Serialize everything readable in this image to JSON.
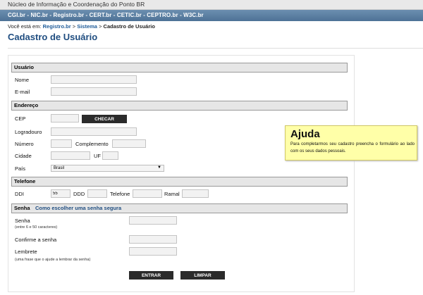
{
  "header": {
    "top_text": "Núcleo de Informação e Coordenação do Ponto BR",
    "nav_text": "CGI.br - NIC.br - Registro.br - CERT.br - CETIC.br - CEPTRO.br - W3C.br"
  },
  "breadcrumb": {
    "prefix": "Você está em:",
    "link1": "Registro.br",
    "sep1": " > ",
    "link2": "Sistema",
    "sep2": " > ",
    "current": "Cadastro de Usuário"
  },
  "page_title": "Cadastro de Usuário",
  "sections": {
    "usuario": "Usuário",
    "endereco": "Endereço",
    "telefone": "Telefone",
    "senha": "Senha",
    "senha_link": "Como escolher uma senha segura"
  },
  "usuario": {
    "nome_label": "Nome",
    "email_label": "E-mail"
  },
  "endereco": {
    "cep_label": "CEP",
    "checar_button": "CHECAR",
    "logradouro_label": "Logradouro",
    "numero_label": "Número",
    "complemento_label": "Complemento",
    "cidade_label": "Cidade",
    "uf_label": "UF",
    "pais_label": "País",
    "pais_value": "Brasil"
  },
  "telefone": {
    "ddi_label": "DDI",
    "ddi_value": "55",
    "ddd_label": "DDD",
    "telefone_label": "Telefone",
    "ramal_label": "Ramal"
  },
  "senha": {
    "senha_label": "Senha",
    "senha_hint": "(entre 6 e 50 caracteres)",
    "confirme_label": "Confirme a senha",
    "lembrete_label": "Lembrete",
    "lembrete_hint": "(uma frase que o ajude a lembrar da senha)"
  },
  "buttons": {
    "entrar": "ENTRAR",
    "limpar": "LIMPAR"
  },
  "help": {
    "title": "Ajuda",
    "body": "Para completarmos seu cadastro preencha o formulário ao lado com os seus dados pessoais."
  }
}
